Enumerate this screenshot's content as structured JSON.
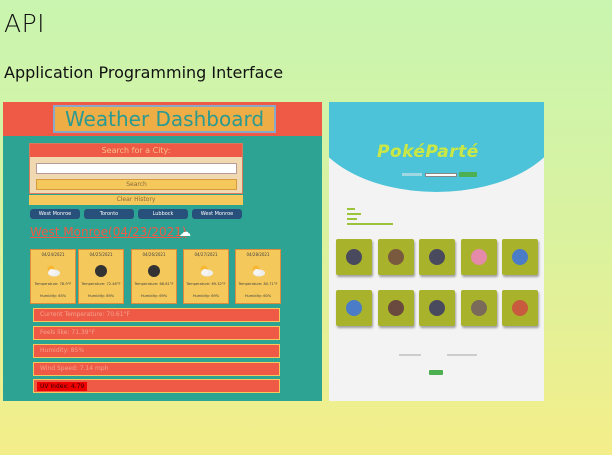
{
  "page": {
    "title": "API",
    "subtitle": "Application Programming Interface"
  },
  "weather_project": {
    "title": "Weather Dashboard",
    "search_header": "Search for a City:",
    "search_placeholder": "",
    "search_button": "Search",
    "clear_button": "Clear History",
    "cities": [
      "West Monroe",
      "Toronto",
      "Lubbock",
      "West Monroe"
    ],
    "current_heading": "West Monroe(04/23/2021)",
    "current_icon": "cloud-icon",
    "forecast": [
      {
        "date": "04/24/2021",
        "icon": "partly-cloudy-icon",
        "temp": "Temperature: 78.9°F",
        "humidity": "Humidity: 65%"
      },
      {
        "date": "04/25/2021",
        "icon": "dark-cloud-icon",
        "temp": "Temperature: 72.46°F",
        "humidity": "Humidity: 89%"
      },
      {
        "date": "04/26/2021",
        "icon": "dark-cloud-icon",
        "temp": "Temperature: 66.81°F",
        "humidity": "Humidity: 69%"
      },
      {
        "date": "04/27/2021",
        "icon": "partly-cloudy-icon",
        "temp": "Temperature: 69.32°F",
        "humidity": "Humidity: 69%"
      },
      {
        "date": "04/28/2021",
        "icon": "partly-cloudy-icon",
        "temp": "Temperature: 80.71°F",
        "humidity": "Humidity: 60%"
      }
    ],
    "stats": [
      {
        "label": "Current Temperature: 70.61°F"
      },
      {
        "label": "Feels like: 71.39°F"
      },
      {
        "label": "Humidity: 85%"
      },
      {
        "label": "Wind Speed: 7.14 mph"
      }
    ],
    "uv": "UV Index: 4.79",
    "colors": {
      "bg": "#2da394",
      "accent": "#ee5a45",
      "panel": "#f4c85b",
      "city": "#27507a"
    }
  },
  "pokemon_project": {
    "logo": "PokéParté",
    "tiles": [
      {
        "color": "#4a4a5e"
      },
      {
        "color": "#7a5a3e"
      },
      {
        "color": "#4a4a5e"
      },
      {
        "color": "#e58aa8"
      },
      {
        "color": "#4a7cc8"
      },
      {
        "color": "#4a7cc8"
      },
      {
        "color": "#6a4a3e"
      },
      {
        "color": "#4a4a5e"
      },
      {
        "color": "#7a6a5a"
      },
      {
        "color": "#c85a3e"
      }
    ],
    "colors": {
      "header": "#4cc3d8",
      "tile": "#a8b22a",
      "logo": "#c8e84a"
    }
  }
}
